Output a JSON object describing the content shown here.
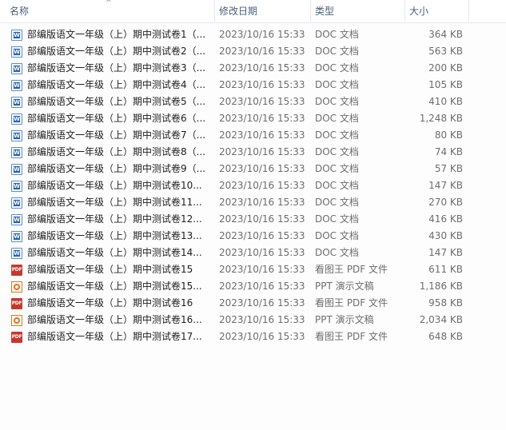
{
  "columns": {
    "name": "名称",
    "date": "修改日期",
    "type": "类型",
    "size": "大小"
  },
  "sort_indicator": "^",
  "files": [
    {
      "icon": "word-doc-icon",
      "name": "部编版语文一年级（上）期中测试卷1（...",
      "date": "2023/10/16 15:33",
      "type": "DOC 文档",
      "size": "364 KB"
    },
    {
      "icon": "word-doc-icon",
      "name": "部编版语文一年级（上）期中测试卷2（...",
      "date": "2023/10/16 15:33",
      "type": "DOC 文档",
      "size": "563 KB"
    },
    {
      "icon": "word-doc-icon",
      "name": "部编版语文一年级（上）期中测试卷3（...",
      "date": "2023/10/16 15:33",
      "type": "DOC 文档",
      "size": "200 KB"
    },
    {
      "icon": "word-doc-icon",
      "name": "部编版语文一年级（上）期中测试卷4（...",
      "date": "2023/10/16 15:33",
      "type": "DOC 文档",
      "size": "105 KB"
    },
    {
      "icon": "word-doc-icon",
      "name": "部编版语文一年级（上）期中测试卷5（...",
      "date": "2023/10/16 15:33",
      "type": "DOC 文档",
      "size": "410 KB"
    },
    {
      "icon": "word-doc-icon",
      "name": "部编版语文一年级（上）期中测试卷6（...",
      "date": "2023/10/16 15:33",
      "type": "DOC 文档",
      "size": "1,248 KB"
    },
    {
      "icon": "word-doc-icon",
      "name": "部编版语文一年级（上）期中测试卷7（...",
      "date": "2023/10/16 15:33",
      "type": "DOC 文档",
      "size": "80 KB"
    },
    {
      "icon": "word-doc-icon",
      "name": "部编版语文一年级（上）期中测试卷8（...",
      "date": "2023/10/16 15:33",
      "type": "DOC 文档",
      "size": "74 KB"
    },
    {
      "icon": "word-doc-icon",
      "name": "部编版语文一年级（上）期中测试卷9（...",
      "date": "2023/10/16 15:33",
      "type": "DOC 文档",
      "size": "57 KB"
    },
    {
      "icon": "word-doc-icon",
      "name": "部编版语文一年级（上）期中测试卷10...",
      "date": "2023/10/16 15:33",
      "type": "DOC 文档",
      "size": "147 KB"
    },
    {
      "icon": "word-doc-icon",
      "name": "部编版语文一年级（上）期中测试卷11...",
      "date": "2023/10/16 15:33",
      "type": "DOC 文档",
      "size": "270 KB"
    },
    {
      "icon": "word-doc-icon",
      "name": "部编版语文一年级（上）期中测试卷12...",
      "date": "2023/10/16 15:33",
      "type": "DOC 文档",
      "size": "416 KB"
    },
    {
      "icon": "word-doc-icon",
      "name": "部编版语文一年级（上）期中测试卷13...",
      "date": "2023/10/16 15:33",
      "type": "DOC 文档",
      "size": "430 KB"
    },
    {
      "icon": "word-doc-icon",
      "name": "部编版语文一年级（上）期中测试卷14...",
      "date": "2023/10/16 15:33",
      "type": "DOC 文档",
      "size": "147 KB"
    },
    {
      "icon": "pdf-icon",
      "name": "部编版语文一年级（上）期中测试卷15",
      "date": "2023/10/16 15:33",
      "type": "看图王 PDF 文件",
      "size": "611 KB"
    },
    {
      "icon": "ppt-icon",
      "name": "部编版语文一年级（上）期中测试卷15...",
      "date": "2023/10/16 15:33",
      "type": "PPT 演示文稿",
      "size": "1,186 KB"
    },
    {
      "icon": "pdf-icon",
      "name": "部编版语文一年级（上）期中测试卷16",
      "date": "2023/10/16 15:33",
      "type": "看图王 PDF 文件",
      "size": "958 KB"
    },
    {
      "icon": "ppt-icon",
      "name": "部编版语文一年级（上）期中测试卷16...",
      "date": "2023/10/16 15:33",
      "type": "PPT 演示文稿",
      "size": "2,034 KB"
    },
    {
      "icon": "pdf-icon",
      "name": "部编版语文一年级（上）期中测试卷17...",
      "date": "2023/10/16 15:33",
      "type": "看图王 PDF 文件",
      "size": "648 KB"
    }
  ],
  "colors": {
    "header_text": "#4c607a",
    "word_icon": "#2b5fb4",
    "pdf_icon": "#c8372d",
    "ppt_icon": "#d9752a"
  }
}
